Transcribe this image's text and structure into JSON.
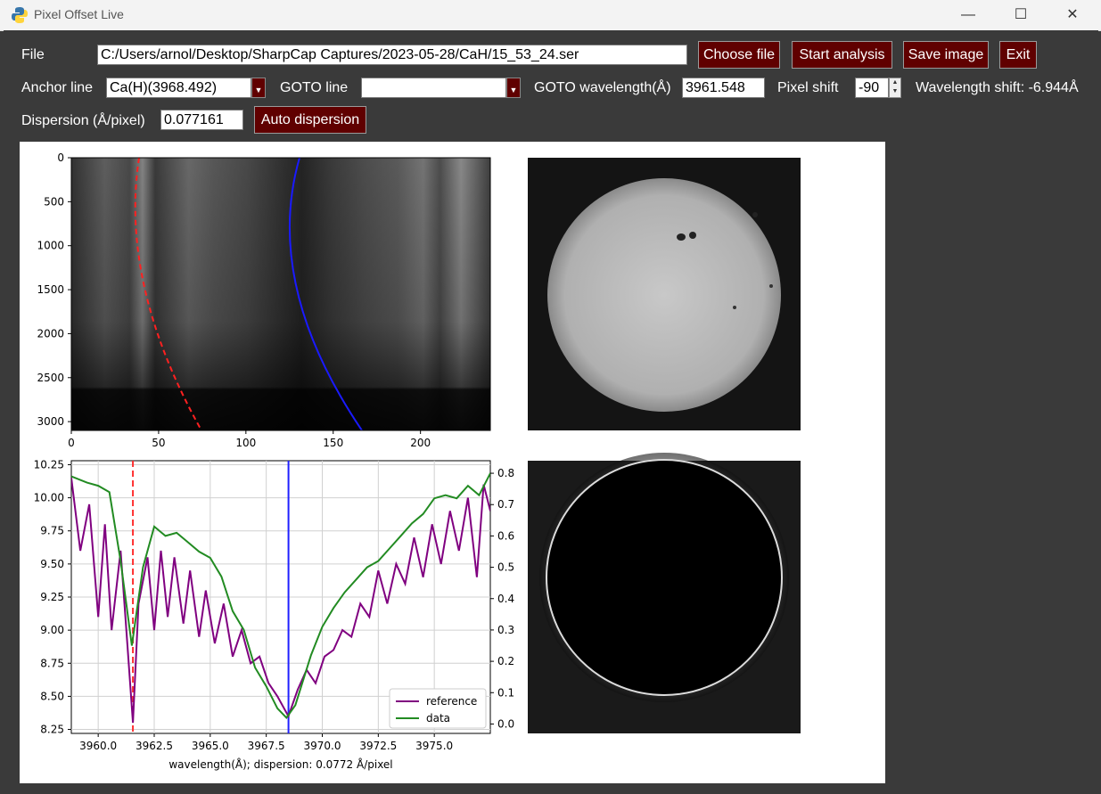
{
  "window": {
    "title": "Pixel Offset Live"
  },
  "toolbar": {
    "file_label": "File",
    "file_path": "C:/Users/arnol/Desktop/SharpCap Captures/2023-05-28/CaH/15_53_24.ser",
    "choose_file": "Choose file",
    "start_analysis": "Start analysis",
    "save_image": "Save image",
    "exit": "Exit",
    "anchor_label": "Anchor line",
    "anchor_value": "Ca(H)(3968.492)",
    "goto_line_label": "GOTO line",
    "goto_line_value": "",
    "goto_wl_label": "GOTO wavelength(Å)",
    "goto_wl_value": "3961.548",
    "pixel_shift_label": "Pixel shift",
    "pixel_shift_value": "-90",
    "wavelength_shift": "Wavelength shift: -6.944Å",
    "dispersion_label": "Dispersion (Å/pixel)",
    "dispersion_value": "0.077161",
    "auto_dispersion": "Auto dispersion"
  },
  "colors": {
    "button_bg": "#600000",
    "window_bg": "#3a3a3a",
    "reference": "#800080",
    "data": "#228b22",
    "anchor_line": "#0000ff",
    "goto_line": "#ff0000"
  },
  "spectrum_image": {
    "x_ticks": [
      "0",
      "50",
      "100",
      "150",
      "200"
    ],
    "y_ticks": [
      "0",
      "500",
      "1000",
      "1500",
      "2000",
      "2500",
      "3000"
    ]
  },
  "profile": {
    "x_ticks": [
      "3960.0",
      "3962.5",
      "3965.0",
      "3967.5",
      "3970.0",
      "3972.5",
      "3975.0"
    ],
    "y_left_ticks": [
      "10.25",
      "10.00",
      "9.75",
      "9.50",
      "9.25",
      "9.00",
      "8.75",
      "8.50",
      "8.25"
    ],
    "y_right_ticks": [
      "0.8",
      "0.7",
      "0.6",
      "0.5",
      "0.4",
      "0.3",
      "0.2",
      "0.1",
      "0.0"
    ],
    "xlabel": "wavelength(Å); dispersion: 0.0772 Å/pixel",
    "legend": [
      "reference",
      "data"
    ]
  },
  "chart_data": {
    "type": "line",
    "xlabel": "wavelength(Å); dispersion: 0.0772 Å/pixel",
    "xlim": [
      3958.8,
      3977.5
    ],
    "ylim_left": [
      8.22,
      10.28
    ],
    "ylim_right": [
      -0.03,
      0.84
    ],
    "markers": {
      "goto_line": 3961.548,
      "anchor_line": 3968.492
    },
    "series": [
      {
        "name": "data",
        "axis": "right",
        "x": [
          3958.8,
          3959.5,
          3960.0,
          3960.5,
          3961.0,
          3961.5,
          3962.0,
          3962.5,
          3963.0,
          3963.5,
          3964.0,
          3964.5,
          3965.0,
          3965.5,
          3966.0,
          3966.5,
          3967.0,
          3967.5,
          3968.0,
          3968.4,
          3968.8,
          3969.5,
          3970.0,
          3970.5,
          3971.0,
          3971.5,
          3972.0,
          3972.5,
          3973.0,
          3973.5,
          3974.0,
          3974.5,
          3975.0,
          3975.5,
          3976.0,
          3976.5,
          3977.0,
          3977.5
        ],
        "y": [
          0.79,
          0.77,
          0.76,
          0.74,
          0.52,
          0.25,
          0.5,
          0.63,
          0.6,
          0.61,
          0.58,
          0.55,
          0.53,
          0.47,
          0.36,
          0.3,
          0.18,
          0.12,
          0.05,
          0.02,
          0.06,
          0.22,
          0.31,
          0.37,
          0.42,
          0.46,
          0.5,
          0.52,
          0.56,
          0.6,
          0.64,
          0.67,
          0.72,
          0.73,
          0.72,
          0.76,
          0.73,
          0.8
        ]
      },
      {
        "name": "reference",
        "axis": "left",
        "x": [
          3958.8,
          3959.2,
          3959.6,
          3960.0,
          3960.3,
          3960.6,
          3961.0,
          3961.3,
          3961.55,
          3961.8,
          3962.2,
          3962.5,
          3962.8,
          3963.1,
          3963.4,
          3963.8,
          3964.1,
          3964.5,
          3964.8,
          3965.2,
          3965.6,
          3966.0,
          3966.4,
          3966.8,
          3967.2,
          3967.6,
          3968.0,
          3968.49,
          3968.9,
          3969.3,
          3969.7,
          3970.1,
          3970.5,
          3970.9,
          3971.3,
          3971.7,
          3972.1,
          3972.5,
          3972.9,
          3973.3,
          3973.7,
          3974.1,
          3974.5,
          3974.9,
          3975.3,
          3975.7,
          3976.1,
          3976.5,
          3976.9,
          3977.2,
          3977.5
        ],
        "y": [
          10.15,
          9.6,
          9.95,
          9.1,
          9.8,
          9.0,
          9.6,
          8.9,
          8.3,
          9.2,
          9.55,
          9.0,
          9.6,
          9.1,
          9.55,
          9.05,
          9.45,
          8.95,
          9.3,
          8.9,
          9.2,
          8.8,
          9.0,
          8.75,
          8.8,
          8.6,
          8.5,
          8.35,
          8.55,
          8.7,
          8.6,
          8.8,
          8.85,
          9.0,
          8.95,
          9.2,
          9.1,
          9.45,
          9.2,
          9.5,
          9.35,
          9.7,
          9.4,
          9.8,
          9.5,
          9.9,
          9.6,
          10.0,
          9.4,
          10.1,
          9.9
        ]
      }
    ]
  }
}
